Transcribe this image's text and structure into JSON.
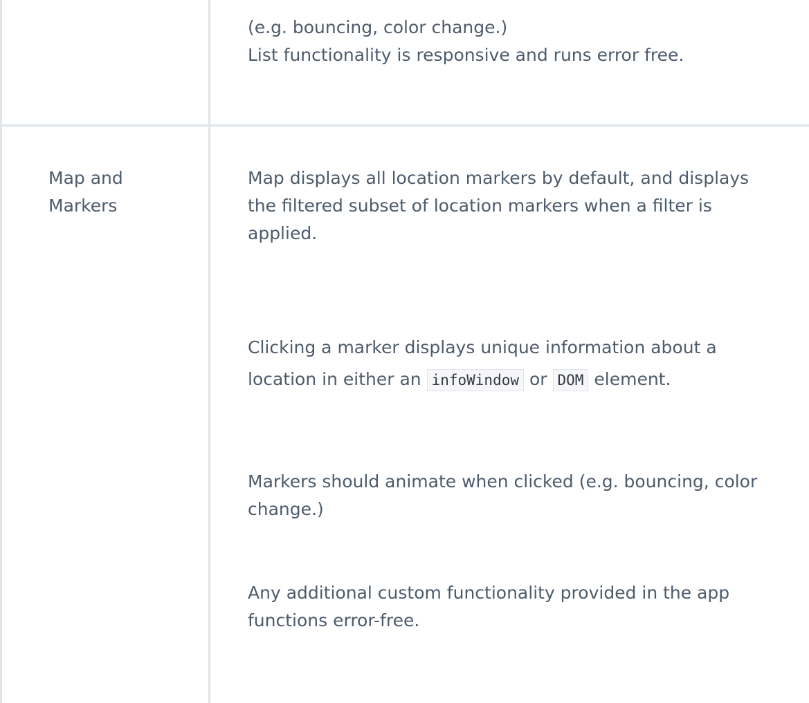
{
  "rows": [
    {
      "lines": [
        "(e.g. bouncing, color change.)",
        "List functionality is responsive and runs error free."
      ]
    },
    {
      "criteria": "Map and Markers",
      "specs": [
        {
          "text": "Map displays all location markers by default, and displays the filtered subset of location markers when a filter is applied."
        },
        {
          "before": "Clicking a marker displays unique information about a location in either an",
          "code1": "infoWindow",
          "middle": "or",
          "code2": "DOM",
          "after": "element."
        },
        {
          "text": "Markers should animate when clicked (e.g. bouncing, color change.)"
        },
        {
          "text": "Any additional custom functionality provided in the app functions error-free."
        }
      ]
    }
  ]
}
